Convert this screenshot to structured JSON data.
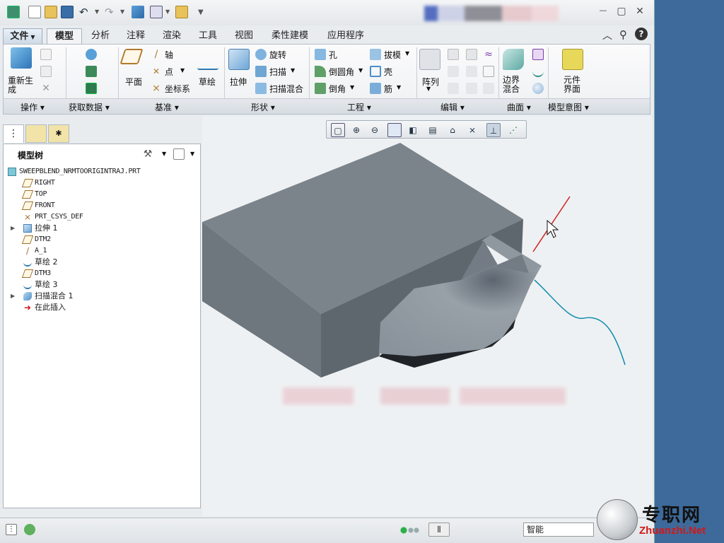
{
  "menu": {
    "tabs": [
      "文件",
      "模型",
      "分析",
      "注释",
      "渲染",
      "工具",
      "视图",
      "柔性建模",
      "应用程序"
    ],
    "active_tab": "模型"
  },
  "window_controls": {
    "minimize": "—",
    "restore": "▢",
    "close": "✕"
  },
  "ribbon": {
    "operations": {
      "regenerate": "重新生成"
    },
    "datum": {
      "plane": "平面",
      "axis": "轴",
      "point": "点",
      "csys": "坐标系"
    },
    "sketch": "草绘",
    "shapes": {
      "extrude": "拉伸",
      "revolve": "旋转",
      "sweep": "扫描",
      "swept_blend": "扫描混合"
    },
    "engineering": {
      "hole": "孔",
      "round": "倒圆角",
      "chamfer": "倒角",
      "draft": "拔模",
      "shell": "壳",
      "rib": "筋"
    },
    "editing": {
      "pattern": "阵列"
    },
    "surfaces": {
      "boundary_blend": "边界混合"
    },
    "model_intent": {
      "component_interface": "元件界面"
    },
    "groups": [
      "操作",
      "获取数据",
      "基准",
      "形状",
      "工程",
      "编辑",
      "曲面",
      "模型意图"
    ]
  },
  "model_tree": {
    "title": "模型树",
    "root": "SWEEPBLEND_NRMTOORIGINTRAJ.PRT",
    "items": [
      {
        "label": "RIGHT",
        "icon": "datum-plane-icon",
        "expandable": false,
        "mono": true
      },
      {
        "label": "TOP",
        "icon": "datum-plane-icon",
        "expandable": false,
        "mono": true
      },
      {
        "label": "FRONT",
        "icon": "datum-plane-icon",
        "expandable": false,
        "mono": true
      },
      {
        "label": "PRT_CSYS_DEF",
        "icon": "csys-icon",
        "expandable": false,
        "mono": true
      },
      {
        "label": "拉伸 1",
        "icon": "extrude-icon",
        "expandable": true,
        "mono": false
      },
      {
        "label": "DTM2",
        "icon": "datum-plane-icon",
        "expandable": false,
        "mono": true
      },
      {
        "label": "A_1",
        "icon": "datum-axis-icon",
        "expandable": false,
        "mono": true
      },
      {
        "label": "草绘 2",
        "icon": "sketch-icon",
        "expandable": false,
        "mono": false
      },
      {
        "label": "DTM3",
        "icon": "datum-plane-icon",
        "expandable": false,
        "mono": true
      },
      {
        "label": "草绘 3",
        "icon": "sketch-icon",
        "expandable": false,
        "mono": false
      },
      {
        "label": "扫描混合 1",
        "icon": "swept-blend-icon",
        "expandable": true,
        "mono": false
      },
      {
        "label": "在此插入",
        "icon": "insert-here-icon",
        "expandable": false,
        "mono": false
      }
    ]
  },
  "status_bar": {
    "filter": "智能"
  },
  "watermark": {
    "cn": "专职网",
    "en": "Zhuanzhi.Net"
  }
}
